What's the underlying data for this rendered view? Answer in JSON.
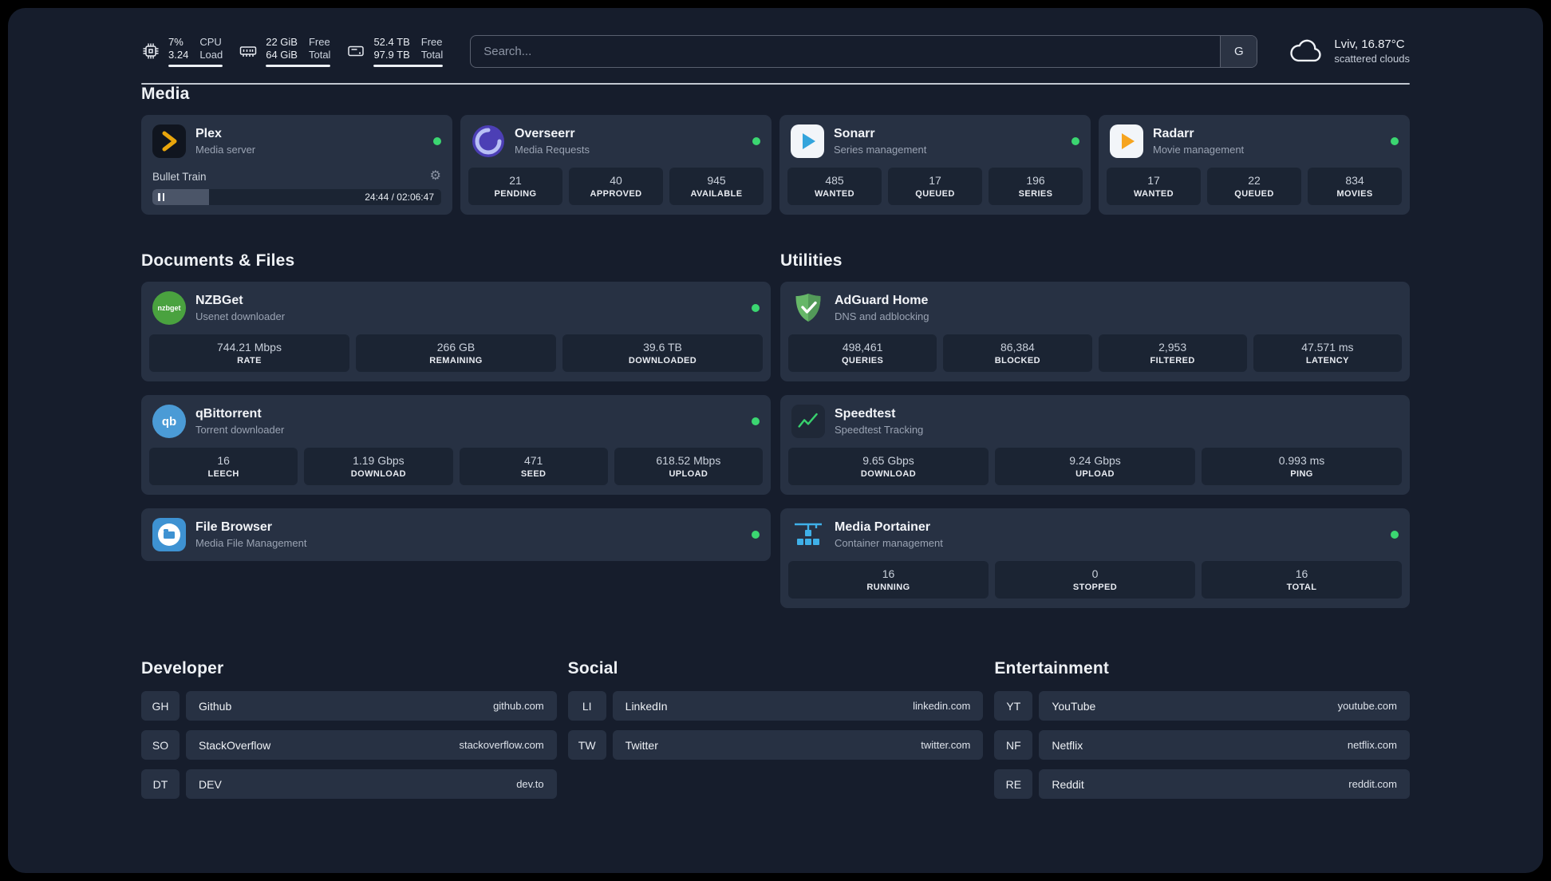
{
  "colors": {
    "status_online": "#3bd671",
    "cpu_bar_accent": "#e7c54a",
    "background": "#161d2c",
    "card": "#273143"
  },
  "topbar": {
    "cpu": {
      "percent": "7%",
      "load": "3.24",
      "label_top": "CPU",
      "label_bottom": "Load"
    },
    "ram": {
      "free": "22 GiB",
      "total": "64 GiB",
      "label_top": "Free",
      "label_bottom": "Total"
    },
    "disk": {
      "free": "52.4 TB",
      "total": "97.9 TB",
      "label_top": "Free",
      "label_bottom": "Total"
    },
    "search": {
      "placeholder": "Search...",
      "engine_label": "G"
    },
    "weather": {
      "location": "Lviv, 16.87°C",
      "condition": "scattered clouds"
    }
  },
  "sections": {
    "media": {
      "title": "Media",
      "apps": [
        {
          "name": "Plex",
          "subtitle": "Media server",
          "online": true,
          "player": {
            "title": "Bullet Train",
            "time": "24:44 / 02:06:47",
            "progress_percent": 19.5
          }
        },
        {
          "name": "Overseerr",
          "subtitle": "Media Requests",
          "online": true,
          "stats": [
            {
              "value": "21",
              "label": "PENDING"
            },
            {
              "value": "40",
              "label": "APPROVED"
            },
            {
              "value": "945",
              "label": "AVAILABLE"
            }
          ]
        },
        {
          "name": "Sonarr",
          "subtitle": "Series management",
          "online": true,
          "stats": [
            {
              "value": "485",
              "label": "WANTED"
            },
            {
              "value": "17",
              "label": "QUEUED"
            },
            {
              "value": "196",
              "label": "SERIES"
            }
          ]
        },
        {
          "name": "Radarr",
          "subtitle": "Movie management",
          "online": true,
          "stats": [
            {
              "value": "17",
              "label": "WANTED"
            },
            {
              "value": "22",
              "label": "QUEUED"
            },
            {
              "value": "834",
              "label": "MOVIES"
            }
          ]
        }
      ]
    },
    "documents": {
      "title": "Documents & Files",
      "apps": [
        {
          "name": "NZBGet",
          "subtitle": "Usenet downloader",
          "online": true,
          "stats": [
            {
              "value": "744.21 Mbps",
              "label": "RATE"
            },
            {
              "value": "266 GB",
              "label": "REMAINING"
            },
            {
              "value": "39.6 TB",
              "label": "DOWNLOADED"
            }
          ]
        },
        {
          "name": "qBittorrent",
          "subtitle": "Torrent downloader",
          "online": true,
          "stats": [
            {
              "value": "16",
              "label": "LEECH"
            },
            {
              "value": "1.19 Gbps",
              "label": "DOWNLOAD"
            },
            {
              "value": "471",
              "label": "SEED"
            },
            {
              "value": "618.52 Mbps",
              "label": "UPLOAD"
            }
          ]
        },
        {
          "name": "File Browser",
          "subtitle": "Media File Management",
          "online": true
        }
      ]
    },
    "utilities": {
      "title": "Utilities",
      "apps": [
        {
          "name": "AdGuard Home",
          "subtitle": "DNS and adblocking",
          "stats": [
            {
              "value": "498,461",
              "label": "QUERIES"
            },
            {
              "value": "86,384",
              "label": "BLOCKED"
            },
            {
              "value": "2,953",
              "label": "FILTERED"
            },
            {
              "value": "47.571 ms",
              "label": "LATENCY"
            }
          ]
        },
        {
          "name": "Speedtest",
          "subtitle": "Speedtest Tracking",
          "stats": [
            {
              "value": "9.65 Gbps",
              "label": "DOWNLOAD"
            },
            {
              "value": "9.24 Gbps",
              "label": "UPLOAD"
            },
            {
              "value": "0.993 ms",
              "label": "PING"
            }
          ]
        },
        {
          "name": "Media Portainer",
          "subtitle": "Container management",
          "online": true,
          "stats": [
            {
              "value": "16",
              "label": "RUNNING"
            },
            {
              "value": "0",
              "label": "STOPPED"
            },
            {
              "value": "16",
              "label": "TOTAL"
            }
          ]
        }
      ]
    }
  },
  "bookmarks": [
    {
      "title": "Developer",
      "items": [
        {
          "abbr": "GH",
          "name": "Github",
          "url": "github.com"
        },
        {
          "abbr": "SO",
          "name": "StackOverflow",
          "url": "stackoverflow.com"
        },
        {
          "abbr": "DT",
          "name": "DEV",
          "url": "dev.to"
        }
      ]
    },
    {
      "title": "Social",
      "items": [
        {
          "abbr": "LI",
          "name": "LinkedIn",
          "url": "linkedin.com"
        },
        {
          "abbr": "TW",
          "name": "Twitter",
          "url": "twitter.com"
        }
      ]
    },
    {
      "title": "Entertainment",
      "items": [
        {
          "abbr": "YT",
          "name": "YouTube",
          "url": "youtube.com"
        },
        {
          "abbr": "NF",
          "name": "Netflix",
          "url": "netflix.com"
        },
        {
          "abbr": "RE",
          "name": "Reddit",
          "url": "reddit.com"
        }
      ]
    }
  ]
}
